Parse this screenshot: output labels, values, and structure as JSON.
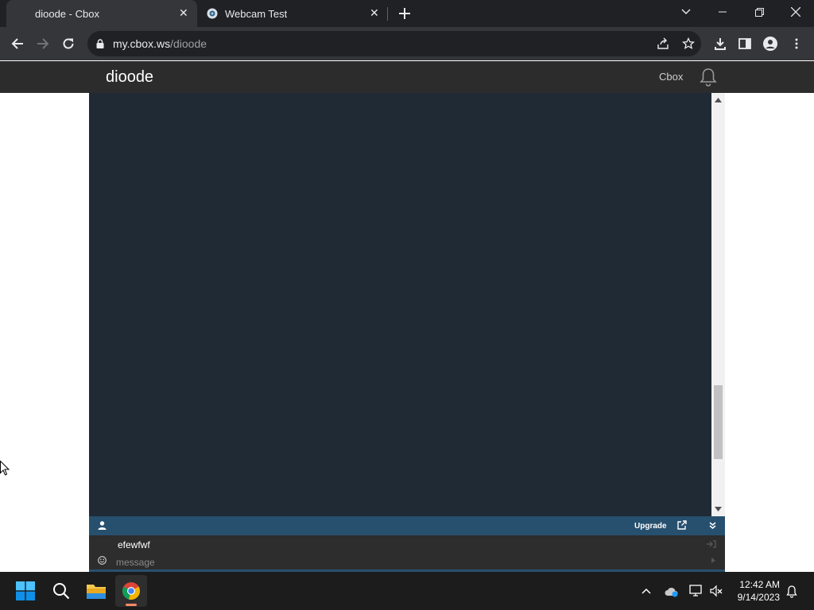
{
  "browser": {
    "tabs": [
      {
        "title": "dioode - Cbox"
      },
      {
        "title": "Webcam Test"
      }
    ],
    "url_domain": "my.cbox.ws",
    "url_path": "/dioode"
  },
  "site": {
    "title": "dioode",
    "nav_link": "Cbox"
  },
  "chat": {
    "upgrade_label": "Upgrade",
    "username": "efewfwf",
    "message_placeholder": "message"
  },
  "taskbar": {
    "time": "12:42 AM",
    "date": "9/14/2023"
  },
  "colors": {
    "chat_bg": "#1f2a34",
    "chat_bar": "#27506f",
    "header_bg": "#2c2c2c"
  }
}
